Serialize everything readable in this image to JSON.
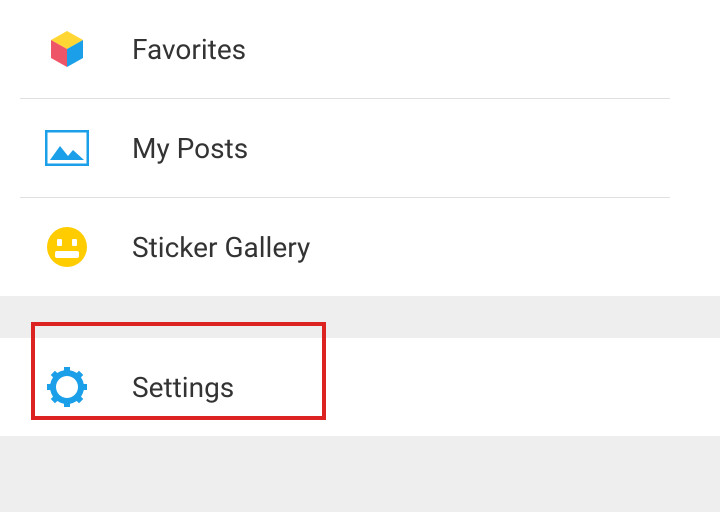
{
  "menu": {
    "favorites": {
      "label": "Favorites"
    },
    "myPosts": {
      "label": "My Posts"
    },
    "stickerGallery": {
      "label": "Sticker Gallery"
    },
    "settings": {
      "label": "Settings"
    }
  }
}
